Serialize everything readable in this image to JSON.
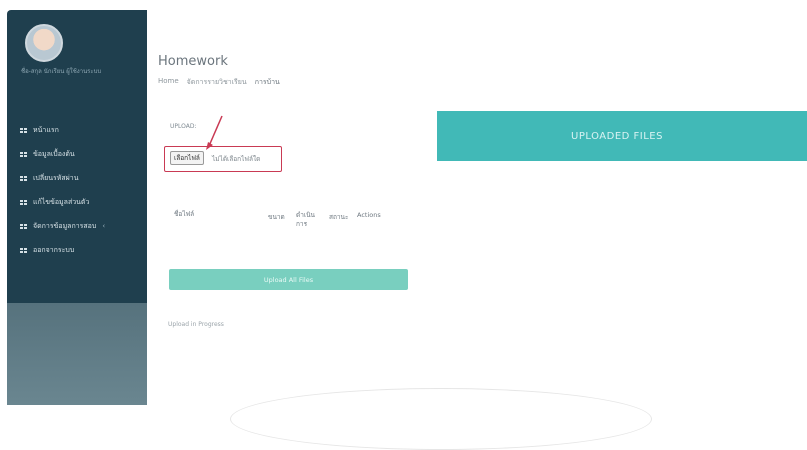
{
  "sidebar": {
    "user_name": "ชื่อ-สกุล นักเรียน ผู้ใช้งานระบบ",
    "items": [
      {
        "label": "หน้าแรก",
        "icon": "grid-icon"
      },
      {
        "label": "ข้อมูลเบื้องต้น",
        "icon": "grid-icon"
      },
      {
        "label": "เปลี่ยนรหัสผ่าน",
        "icon": "grid-icon"
      },
      {
        "label": "แก้ไขข้อมูลส่วนตัว",
        "icon": "grid-icon"
      },
      {
        "label": "จัดการข้อมูลการสอบ",
        "icon": "grid-icon",
        "chevron": "‹"
      },
      {
        "label": "ออกจากระบบ",
        "icon": "grid-icon"
      }
    ]
  },
  "header": {
    "title": "Homework",
    "breadcrumb": [
      "Home",
      "จัดการรายวิชาเรียน",
      "การบ้าน"
    ]
  },
  "upload": {
    "label": "UPLOAD:",
    "choose_file_label": "เลือกไฟล์",
    "no_file_text": "ไม่ได้เลือกไฟล์ใด"
  },
  "table": {
    "headers": [
      "ชื่อไฟล์",
      "ขนาด",
      "ดำเนินการ",
      "สถานะ",
      "Actions"
    ]
  },
  "upload_all_label": "Upload All Files",
  "progress_label": "Upload in Progress",
  "uploaded_files_label": "UPLOADED FILES",
  "colors": {
    "sidebar": "#1f3f4e",
    "accent_teal": "#41b9b7",
    "upload_button": "#79cfbf",
    "highlight_box": "#c93a54"
  }
}
